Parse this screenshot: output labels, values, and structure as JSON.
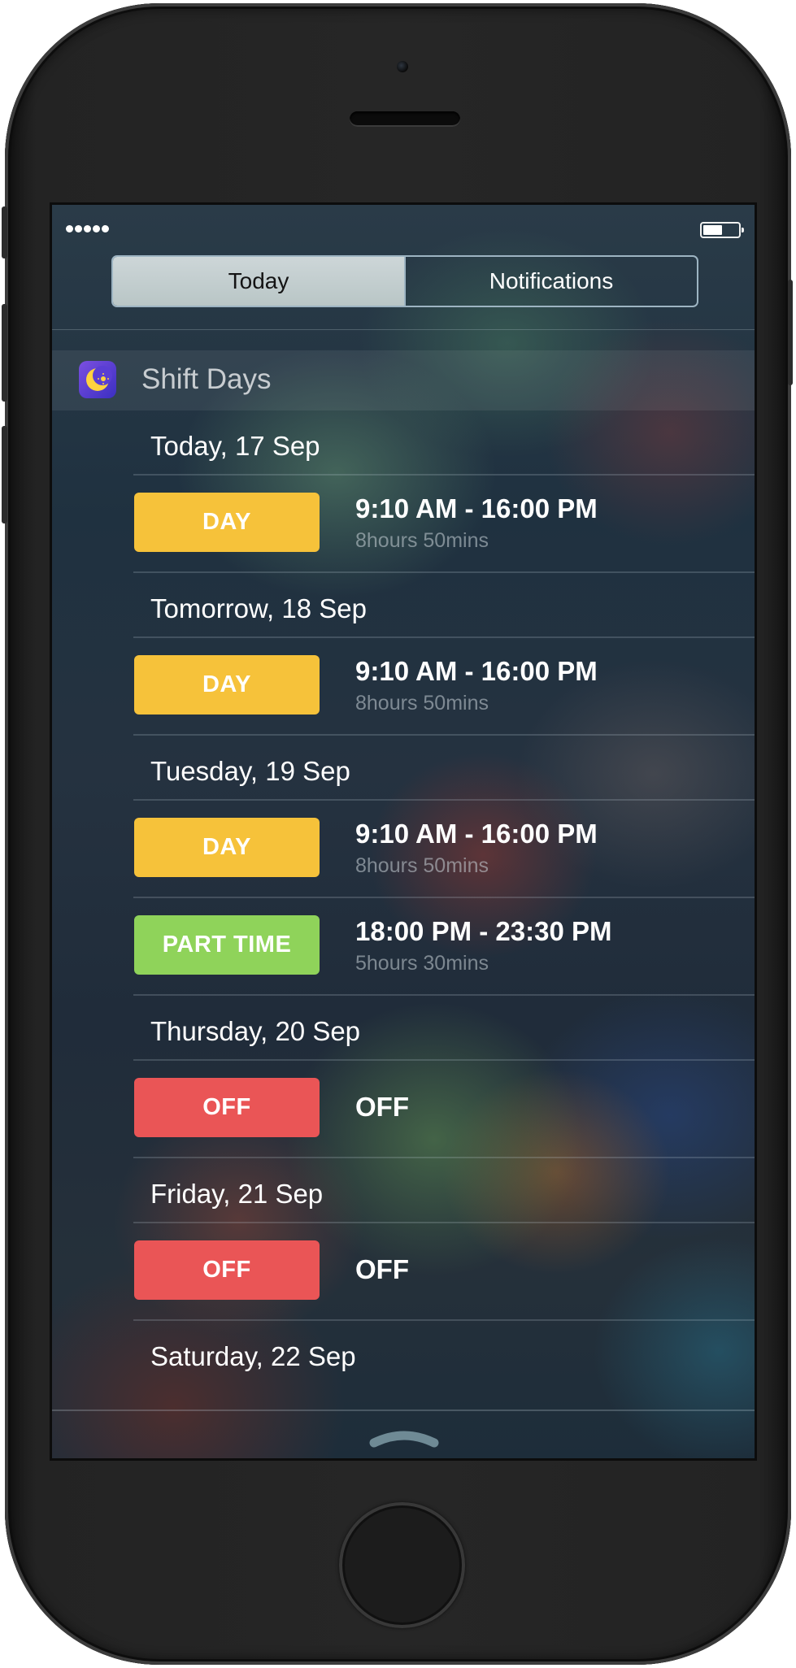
{
  "status_bar": {
    "signal_icon": "signal-dots-icon",
    "battery_icon": "battery-icon",
    "battery_level": 0.55
  },
  "segmented_control": {
    "tabs": [
      {
        "label": "Today",
        "active": true
      },
      {
        "label": "Notifications",
        "active": false
      }
    ]
  },
  "widget": {
    "app_name": "Shift Days",
    "app_icon": "moon-sun-icon"
  },
  "days": [
    {
      "date": "Today, 17 Sep",
      "shifts": [
        {
          "badge": "DAY",
          "badge_color": "#F6C23A",
          "time": "9:10 AM - 16:00 PM",
          "duration": "8hours 50mins"
        }
      ]
    },
    {
      "date": "Tomorrow, 18 Sep",
      "shifts": [
        {
          "badge": "DAY",
          "badge_color": "#F6C23A",
          "time": "9:10 AM - 16:00 PM",
          "duration": "8hours 50mins"
        }
      ]
    },
    {
      "date": "Tuesday, 19 Sep",
      "shifts": [
        {
          "badge": "DAY",
          "badge_color": "#F6C23A",
          "time": "9:10 AM - 16:00 PM",
          "duration": "8hours 50mins"
        },
        {
          "badge": "PART TIME",
          "badge_color": "#8FD35A",
          "time": "18:00 PM - 23:30 PM",
          "duration": "5hours 30mins"
        }
      ]
    },
    {
      "date": "Thursday, 20 Sep",
      "shifts": [
        {
          "badge": "OFF",
          "badge_color": "#EA5556",
          "off_text": "OFF"
        }
      ]
    },
    {
      "date": "Friday, 21 Sep",
      "shifts": [
        {
          "badge": "OFF",
          "badge_color": "#EA5556",
          "off_text": "OFF"
        }
      ]
    },
    {
      "date": "Saturday, 22 Sep",
      "shifts": []
    }
  ],
  "grabber_icon": "chevron-up-icon"
}
